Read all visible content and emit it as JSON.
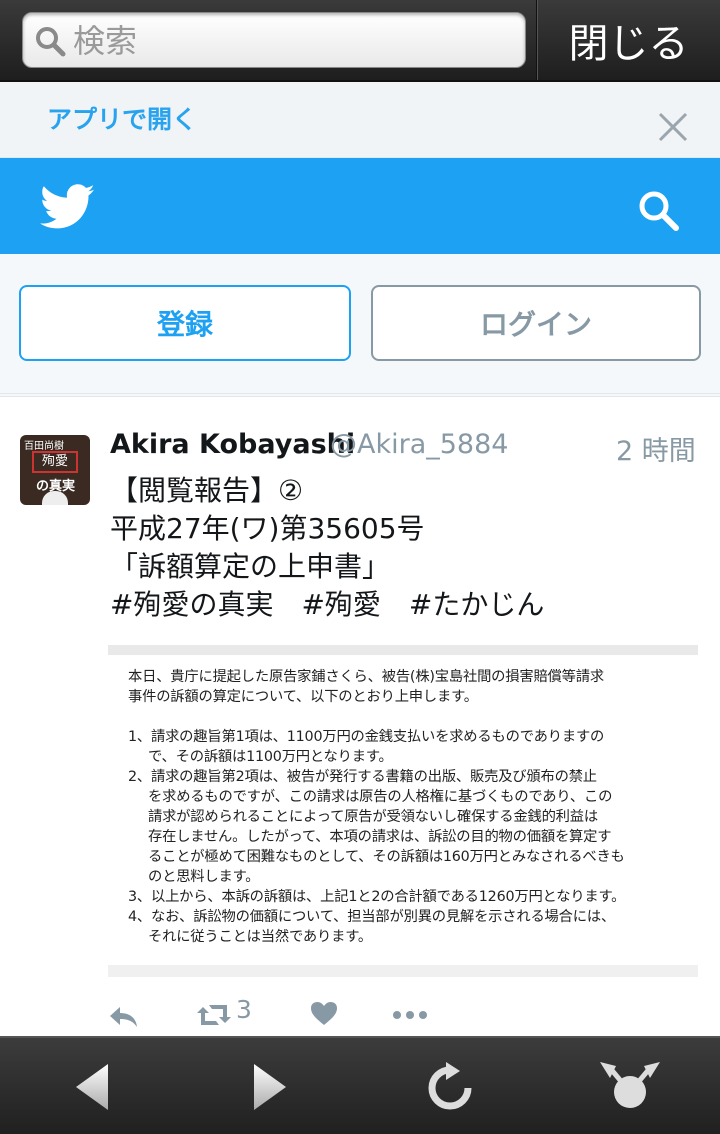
{
  "browser": {
    "search_placeholder": "検索",
    "close_label": "閉じる"
  },
  "banner": {
    "open_app_label": "アプリで開く"
  },
  "auth": {
    "signup_label": "登録",
    "login_label": "ログイン"
  },
  "tweet": {
    "name": "Akira Kobayashi",
    "handle": "@Akira_5884",
    "time": "2 時間",
    "lines": [
      "【閲覧報告】②",
      "平成27年(ワ)第35605号",
      "「訴額算定の上申書」",
      "#殉愛の真実　#殉愛　#たかじん"
    ],
    "avatar_text": [
      "百田尚樹",
      "殉愛",
      "の真実"
    ],
    "image_lines": [
      "本日、貴庁に提起した原告家鋪さくら、被告(株)宝島社間の損害賠償等請求",
      "事件の訴額の算定について、以下のとおり上申します。",
      "1、請求の趣旨第1項は、1100万円の金銭支払いを求めるものでありますの",
      "で、その訴額は1100万円となります。",
      "2、請求の趣旨第2項は、被告が発行する書籍の出版、販売及び頒布の禁止",
      "を求めるものですが、この請求は原告の人格権に基づくものであり、この",
      "請求が認められることによって原告が受領ないし確保する金銭的利益は",
      "存在しません。したがって、本項の請求は、訴訟の目的物の価額を算定す",
      "ることが極めて困難なものとして、その訴額は160万円とみなされるべきも",
      "のと思料します。",
      "3、以上から、本訴の訴額は、上記1と2の合計額である1260万円となります。",
      "4、なお、訴訟物の価額について、担当部が別異の見解を示される場合には、",
      "それに従うことは当然であります。"
    ],
    "retweet_count": "3"
  },
  "colors": {
    "twitter_blue": "#1da1f2",
    "muted_gray": "#8899a6"
  }
}
